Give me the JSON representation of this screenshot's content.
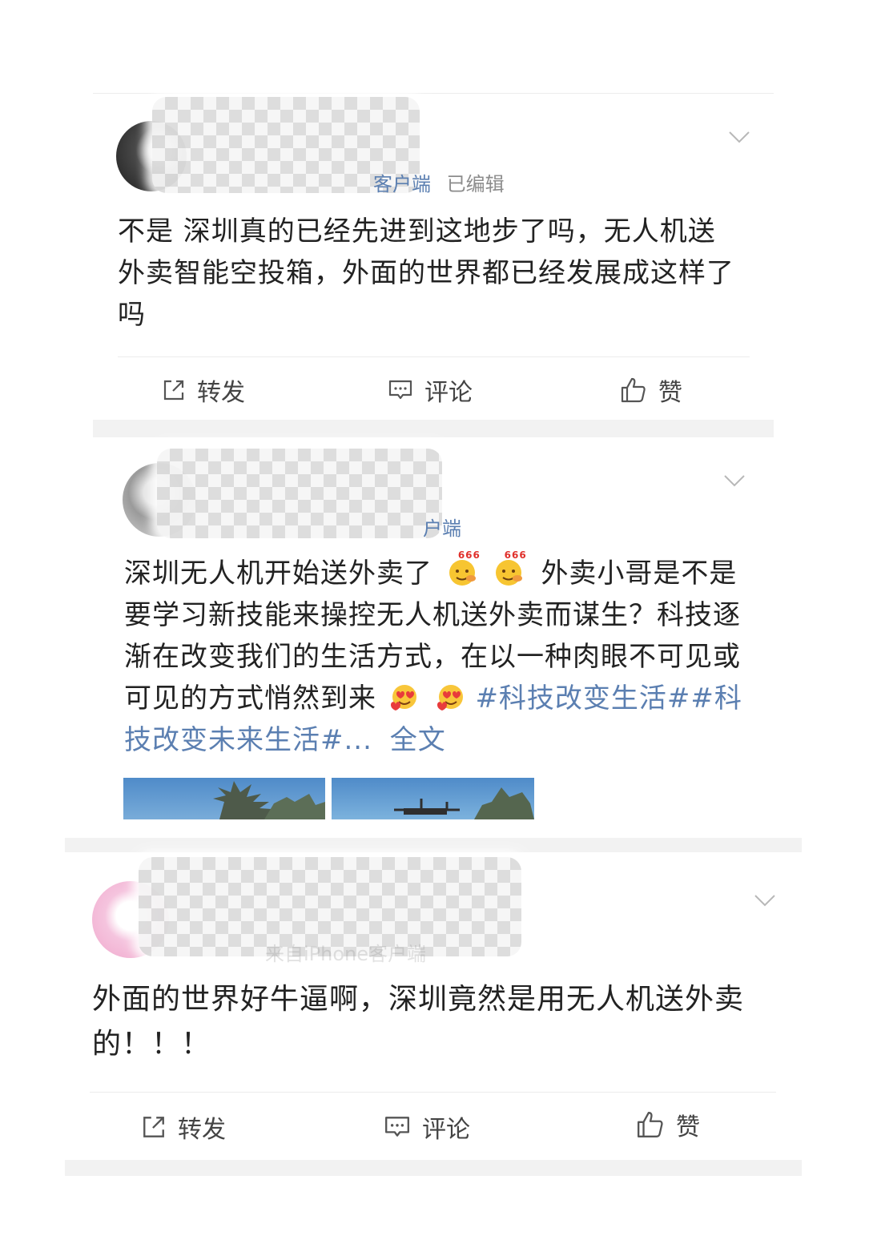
{
  "posts": [
    {
      "meta_blue": "客户端",
      "meta_tail": "已编辑",
      "text": "不是 深圳真的已经先进到这地步了吗，无人机送外卖智能空投箱，外面的世界都已经发展成这样了吗",
      "actions": {
        "repost": "转发",
        "comment": "评论",
        "like": "赞"
      }
    },
    {
      "meta_blue": "户端",
      "text_plain": "深圳无人机开始送外卖了",
      "emoji_1": "666",
      "emoji_2": "666",
      "text_plain_2": "外卖小哥是不是要学习新技能来操控无人机送外卖而谋生？科技逐渐在改变我们的生活方式，在以一种肉眼不可见或可见的方式悄然到来",
      "topic_text": "#科技改变生活##科技改变未来生活#...",
      "full_text_link": "全文"
    },
    {
      "meta_gray": "来自iPhone客户端",
      "text": "外面的世界好牛逼啊，深圳竟然是用无人机送外卖的！！！",
      "actions": {
        "repost": "转发",
        "comment": "评论",
        "like": "赞"
      }
    }
  ],
  "colors": {
    "link_blue": "#5b7fb1",
    "text": "#222222",
    "meta": "#8c8c8c",
    "band": "#f2f2f2"
  }
}
